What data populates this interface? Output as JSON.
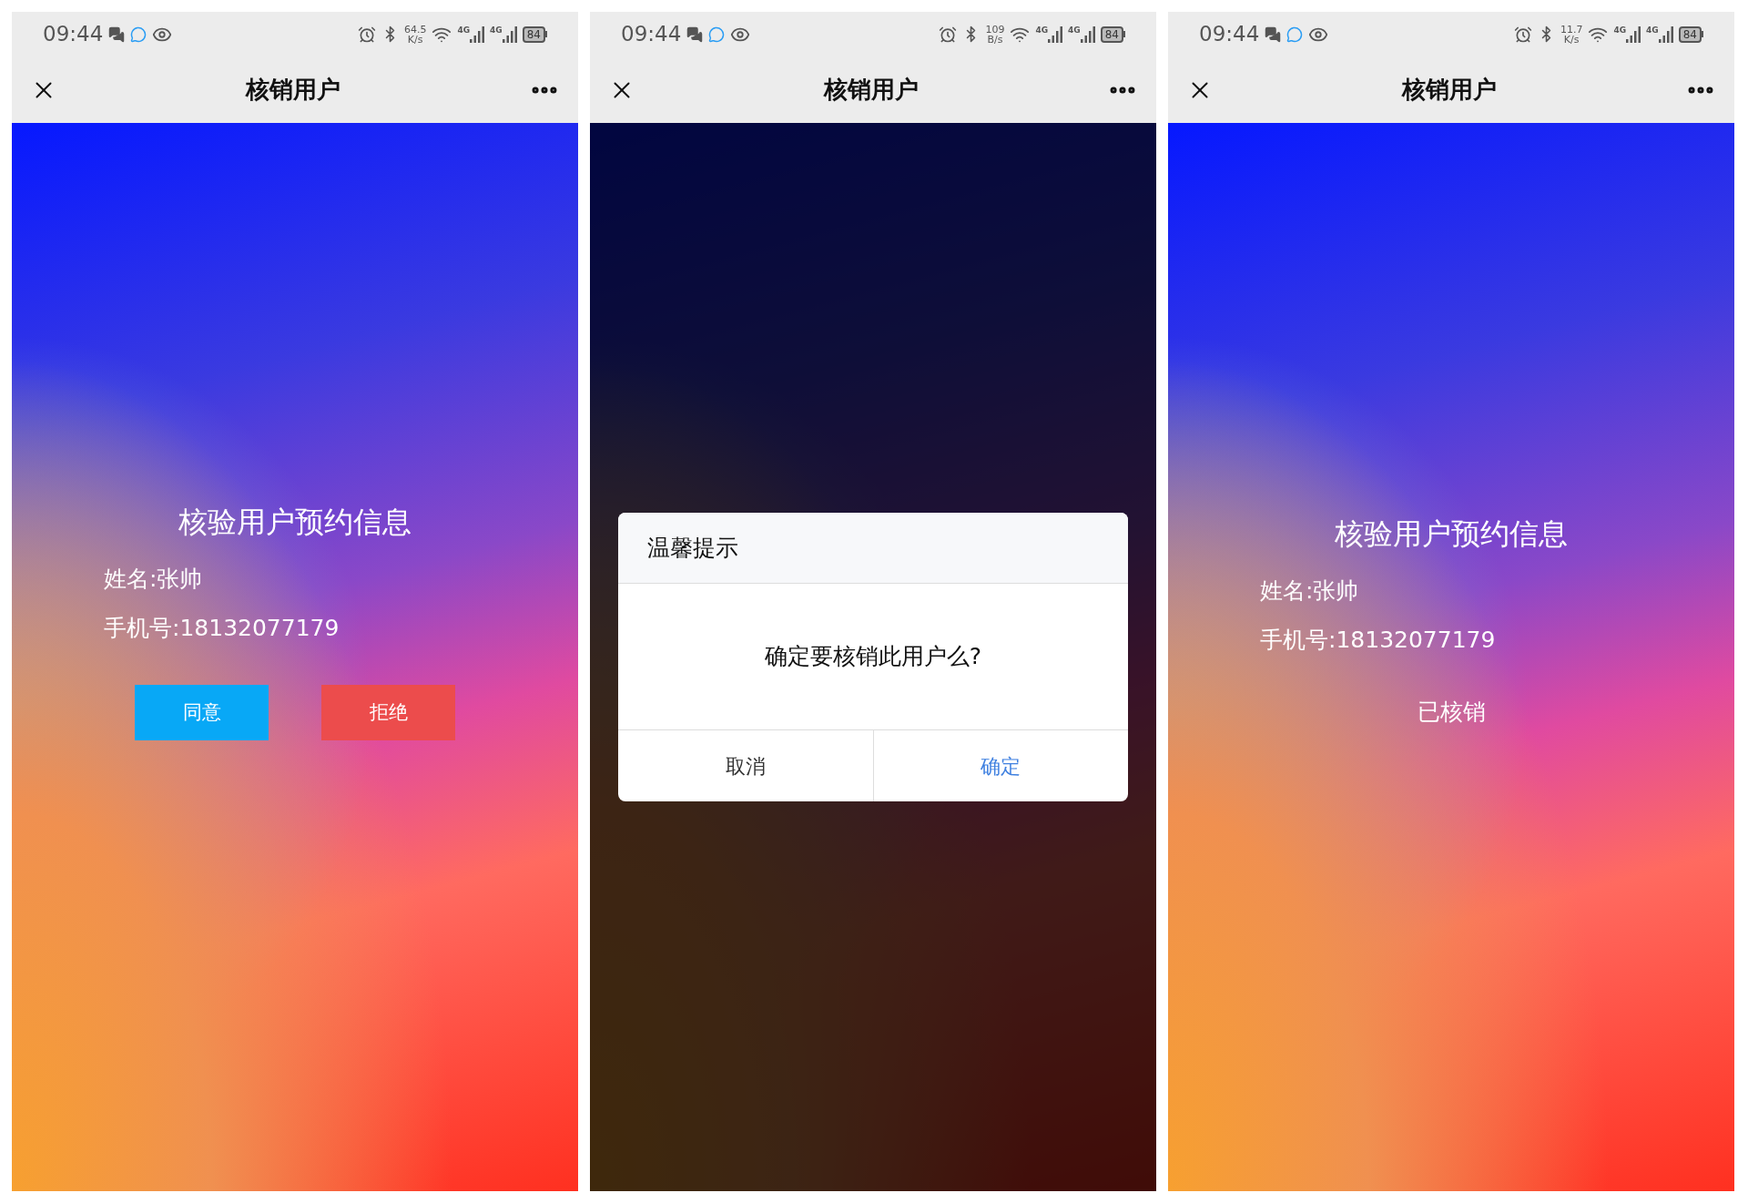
{
  "screens": [
    {
      "kind": "form",
      "status_bar": {
        "time": "09:44",
        "speed_value": "64.5",
        "speed_unit": "K/s",
        "network_1": "4G",
        "network_2": "4G",
        "battery": "84"
      },
      "title": "核销用户",
      "heading": "核验用户预约信息",
      "name_line": "姓名:张帅",
      "phone_line": "手机号:18132077179",
      "buttons": [
        {
          "label": "同意",
          "kind": "agree"
        },
        {
          "label": "拒绝",
          "kind": "reject"
        }
      ]
    },
    {
      "kind": "dialog",
      "status_bar": {
        "time": "09:44",
        "speed_value": "109",
        "speed_unit": "B/s",
        "network_1": "4G",
        "network_2": "4G",
        "battery": "84"
      },
      "title": "核销用户",
      "dialog": {
        "title": "温馨提示",
        "message": "确定要核销此用户么?",
        "buttons": [
          {
            "label": "取消",
            "kind": "cancel"
          },
          {
            "label": "确定",
            "kind": "confirm"
          }
        ]
      }
    },
    {
      "kind": "done",
      "status_bar": {
        "time": "09:44",
        "speed_value": "11.7",
        "speed_unit": "K/s",
        "network_1": "4G",
        "network_2": "4G",
        "battery": "84"
      },
      "title": "核销用户",
      "heading": "核验用户预约信息",
      "name_line": "姓名:张帅",
      "phone_line": "手机号:18132077179",
      "status_text": "已核销"
    }
  ]
}
